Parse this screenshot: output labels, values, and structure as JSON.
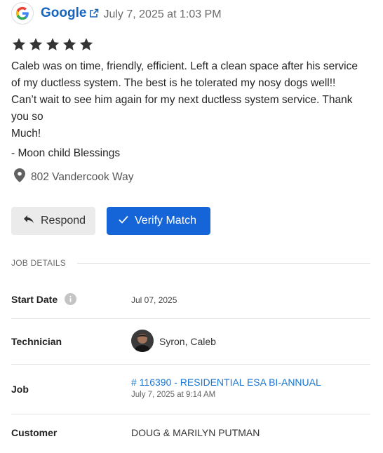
{
  "review": {
    "source": "Google",
    "date": "July 7, 2025 at 1:03 PM",
    "rating": 5,
    "text_lines": [
      "Caleb was on time, friendly, efficient. Left a clean space after his service",
      "of my ductless system. The best is he tolerated my nosy dogs well!!",
      "Can’t wait to see him again for my next ductless system service. Thank",
      "you so",
      "Much!"
    ],
    "signature": "- Moon child Blessings",
    "location": "802 Vandercook Way"
  },
  "actions": {
    "respond_label": "Respond",
    "verify_label": "Verify Match"
  },
  "job_details": {
    "section_title": "JOB DETAILS",
    "start_date_label": "Start Date",
    "start_date_value": "Jul 07, 2025",
    "technician_label": "Technician",
    "technician_name": "Syron, Caleb",
    "job_label": "Job",
    "job_link": "# 116390 - RESIDENTIAL ESA BI-ANNUAL",
    "job_date": "July 7, 2025 at 9:14 AM",
    "customer_label": "Customer",
    "customer_value": "DOUG & MARILYN PUTMAN"
  },
  "colors": {
    "link": "#1565c0",
    "primary_button": "#1565d8",
    "star": "#333333"
  }
}
